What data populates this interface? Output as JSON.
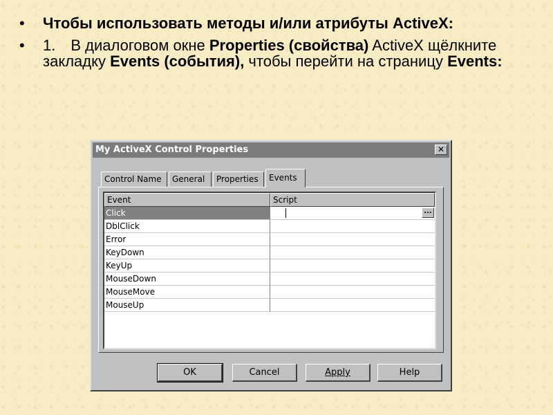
{
  "slide": {
    "bullet1": {
      "text": "Чтобы использовать методы и/или атрибуты ActiveX:"
    },
    "bullet2": {
      "number": "1.",
      "t1": "В диалоговом окне ",
      "t2": "Properties (свойства)",
      "t3": " ActiveX щёлкните закладку ",
      "t4": "Events (события),",
      "t5": " чтобы перейти на страницу ",
      "t6": "Events:"
    }
  },
  "dialog": {
    "title": "My ActiveX Control Properties",
    "close_glyph": "✕",
    "tabs": [
      {
        "label": "Control Name"
      },
      {
        "label": "General"
      },
      {
        "label": "Properties"
      },
      {
        "label": "Events"
      }
    ],
    "active_tab": "Events",
    "grid": {
      "columns": [
        "Event",
        "Script"
      ],
      "rows": [
        {
          "event": "Click",
          "script": ""
        },
        {
          "event": "DblClick",
          "script": ""
        },
        {
          "event": "Error",
          "script": ""
        },
        {
          "event": "KeyDown",
          "script": ""
        },
        {
          "event": "KeyUp",
          "script": ""
        },
        {
          "event": "MouseDown",
          "script": ""
        },
        {
          "event": "MouseMove",
          "script": ""
        },
        {
          "event": "MouseUp",
          "script": ""
        }
      ],
      "ellipsis_label": "..."
    },
    "buttons": {
      "ok": "OK",
      "cancel": "Cancel",
      "apply": "Apply",
      "help": "Help"
    }
  }
}
